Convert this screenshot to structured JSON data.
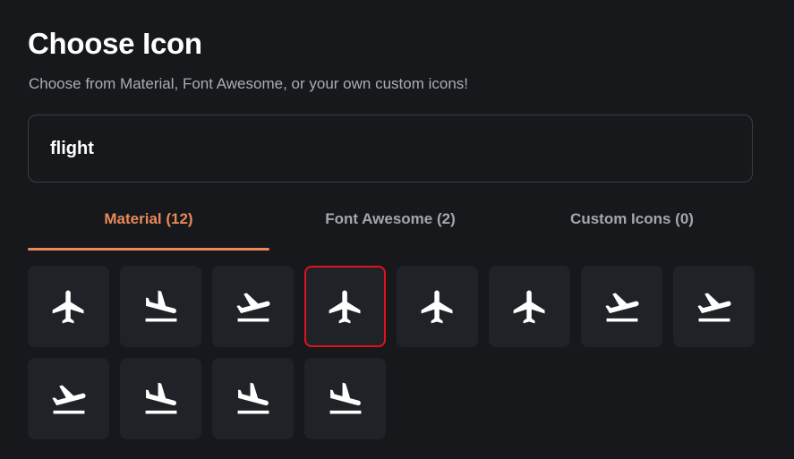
{
  "dialog": {
    "title": "Choose Icon",
    "subtitle": "Choose from Material, Font Awesome, or your own custom icons!"
  },
  "search": {
    "value": "flight",
    "placeholder": ""
  },
  "tabs": [
    {
      "label": "Material (12)",
      "active": true
    },
    {
      "label": "Font Awesome (2)",
      "active": false
    },
    {
      "label": "Custom Icons (0)",
      "active": false
    }
  ],
  "icons": [
    {
      "name": "flight-icon",
      "glyph": "plane"
    },
    {
      "name": "flight-land-icon",
      "glyph": "land"
    },
    {
      "name": "flight-takeoff-icon",
      "glyph": "takeoff"
    },
    {
      "name": "flight-icon",
      "glyph": "plane",
      "selected": true
    },
    {
      "name": "flight-icon",
      "glyph": "plane"
    },
    {
      "name": "flight-icon",
      "glyph": "plane"
    },
    {
      "name": "flight-takeoff-icon",
      "glyph": "takeoff"
    },
    {
      "name": "flight-takeoff-icon",
      "glyph": "takeoff"
    },
    {
      "name": "flight-takeoff-icon",
      "glyph": "takeoff"
    },
    {
      "name": "flight-land-icon",
      "glyph": "land"
    },
    {
      "name": "flight-land-icon",
      "glyph": "land"
    },
    {
      "name": "flight-land-icon",
      "glyph": "land"
    }
  ],
  "colors": {
    "accent": "#e9895a",
    "selected_border": "#e0121c",
    "tile_background": "#1f2327",
    "background": "#16181b"
  }
}
